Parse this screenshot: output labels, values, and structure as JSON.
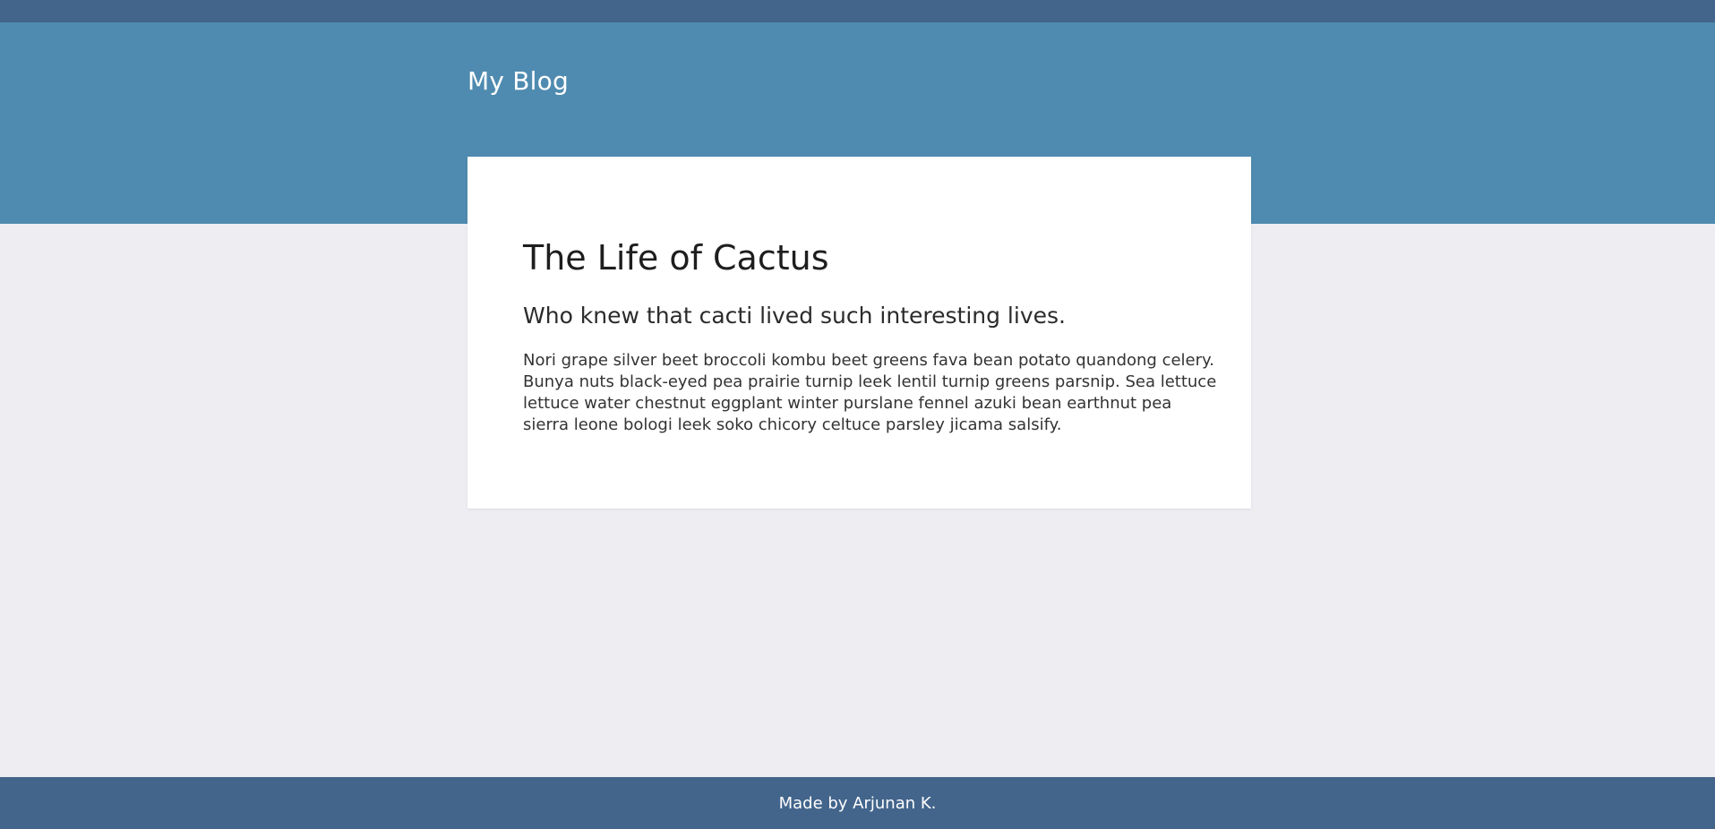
{
  "header": {
    "site_title": "My Blog"
  },
  "post": {
    "title": "The Life of Cactus",
    "subtitle": "Who knew that cacti lived such interesting lives.",
    "body": "Nori grape silver beet broccoli kombu beet greens fava bean potato quandong celery. Bunya nuts black-eyed pea prairie turnip leek lentil turnip greens parsnip. Sea lettuce lettuce water chestnut eggplant winter purslane fennel azuki bean earthnut pea sierra leone bologi leek soko chicory celtuce parsley jicama salsify."
  },
  "footer": {
    "credit": "Made by Arjunan K."
  },
  "colors": {
    "topbar": "#43658b",
    "hero": "#4f8bb0",
    "page_background": "#eeedf2",
    "card": "#ffffff",
    "footer": "#43658b"
  }
}
